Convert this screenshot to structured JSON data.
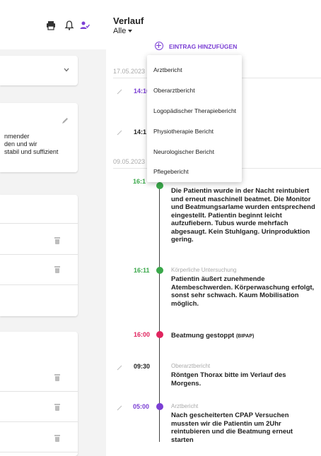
{
  "left": {
    "icons": [
      "printer-icon",
      "bell-icon",
      "person-check-icon"
    ],
    "colors": {
      "accent": "#7b3fd4"
    },
    "card2_lines": [
      "nmender",
      "den und wir",
      "stabil und suffizient"
    ]
  },
  "header": {
    "title": "Verlauf",
    "filter": "Alle"
  },
  "add_entry_label": "EINTRAG HINZUFÜGEN",
  "menu": {
    "items": [
      "Arztbericht",
      "Oberarztbericht",
      "Logopädischer Therapiebericht",
      "Physiotherapie Bericht",
      "Neurologischer Bericht",
      "Pflegebericht"
    ]
  },
  "dates": [
    "17.05.2023",
    "09.05.2023"
  ],
  "entries_top": [
    {
      "time": "14:16",
      "color": "#7b3fd4"
    },
    {
      "time": "14:1",
      "color": "#222222"
    }
  ],
  "entries": [
    {
      "time": "16:1",
      "type": "",
      "text": "Die Patientin wurde in der Nacht reintubiert und erneut maschinell beatmet. Die Monitor und Beatmungsarlame wurden entsprechend eingestellt. Patientin beginnt leicht aufzufiebern. Tubus wurde mehrfach abgesaugt. Kein Stuhlgang. Urinproduktion gering.",
      "color": "#3aa84a"
    },
    {
      "time": "16:11",
      "type": "Körperliche Untersuchung",
      "text": "Patientin äußert zunehmende Atembeschwerden. Körperwaschung erfolgt, sonst sehr schwach. Kaum Mobilisation möglich.",
      "color": "#3aa84a"
    },
    {
      "time": "16:00",
      "type": "",
      "text": "Beatmung gestoppt",
      "suffix": "(BIPAP)",
      "color": "#e0245e"
    },
    {
      "time": "09:30",
      "type": "Oberarztbericht",
      "text": "Röntgen Thorax bitte im Verlauf des Morgens.",
      "color": "#222222"
    },
    {
      "time": "05:00",
      "type": "Arztbericht",
      "text": "Nach gescheiterten CPAP Versuchen mussten wir die Patientin um 2Uhr reintubieren und die Beatmung erneut starten",
      "color": "#7b3fd4"
    }
  ]
}
